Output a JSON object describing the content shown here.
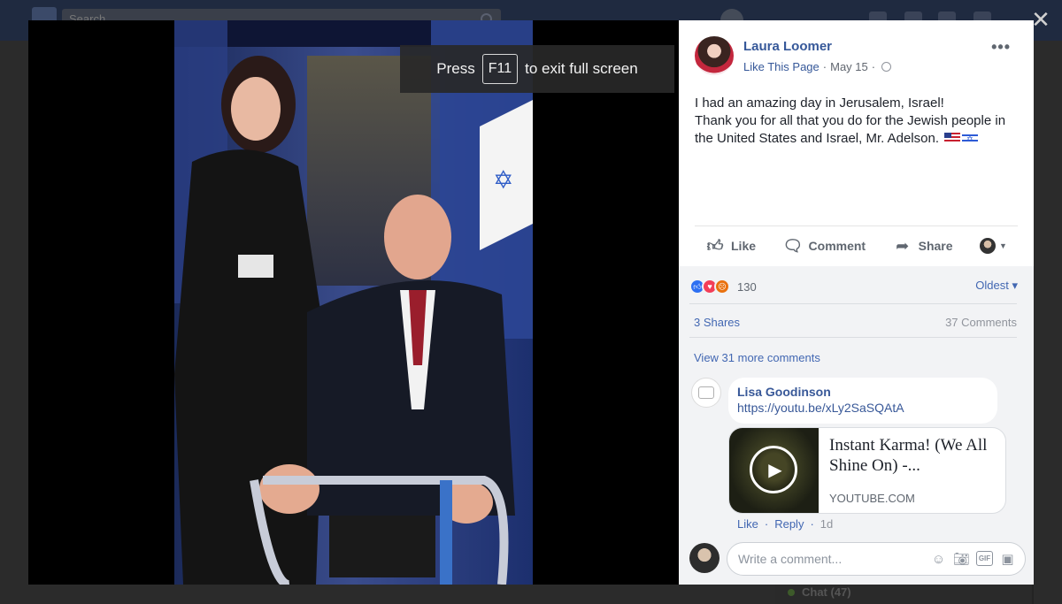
{
  "background": {
    "search_placeholder": "Search",
    "chat_label": "Chat (47)"
  },
  "fullscreen_banner": {
    "prefix": "Press",
    "key": "F11",
    "suffix": "to exit full screen"
  },
  "close_glyph": "✕",
  "post": {
    "author": "Laura Loomer",
    "like_page": "Like This Page",
    "separator": "·",
    "date": "May 15",
    "more_glyph": "•••",
    "text_line1": "I had an amazing day in Jerusalem, Israel!",
    "text_line2": "Thank you for all that you do for the Jewish people in the United States and Israel, Mr. Adelson."
  },
  "actions": {
    "like": "Like",
    "comment": "Comment",
    "share": "Share"
  },
  "reactions": {
    "count": "130",
    "sort_label": "Oldest ▾"
  },
  "stats": {
    "shares": "3 Shares",
    "comments": "37 Comments"
  },
  "view_more": "View 31 more comments",
  "comment": {
    "author": "Lisa Goodinson",
    "link": "https://youtu.be/xLy2SaSQAtA",
    "preview_title": "Instant Karma! (We All Shine On) -...",
    "preview_domain": "YOUTUBE.COM",
    "like": "Like",
    "reply": "Reply",
    "dot": "·",
    "time": "1d"
  },
  "composer": {
    "placeholder": "Write a comment..."
  },
  "icons": {
    "like": "thumbs-up-icon",
    "comment": "speech-bubble-icon",
    "share": "share-arrow-icon",
    "emoji": "emoji-icon",
    "camera": "camera-icon",
    "gif": "gif-icon",
    "sticker": "sticker-icon",
    "globe": "globe-icon",
    "play": "play-icon"
  },
  "colors": {
    "link_blue": "#365899",
    "like_blue": "#2d6ff2",
    "love_red": "#f33e58",
    "angry_orange": "#e9710f"
  }
}
